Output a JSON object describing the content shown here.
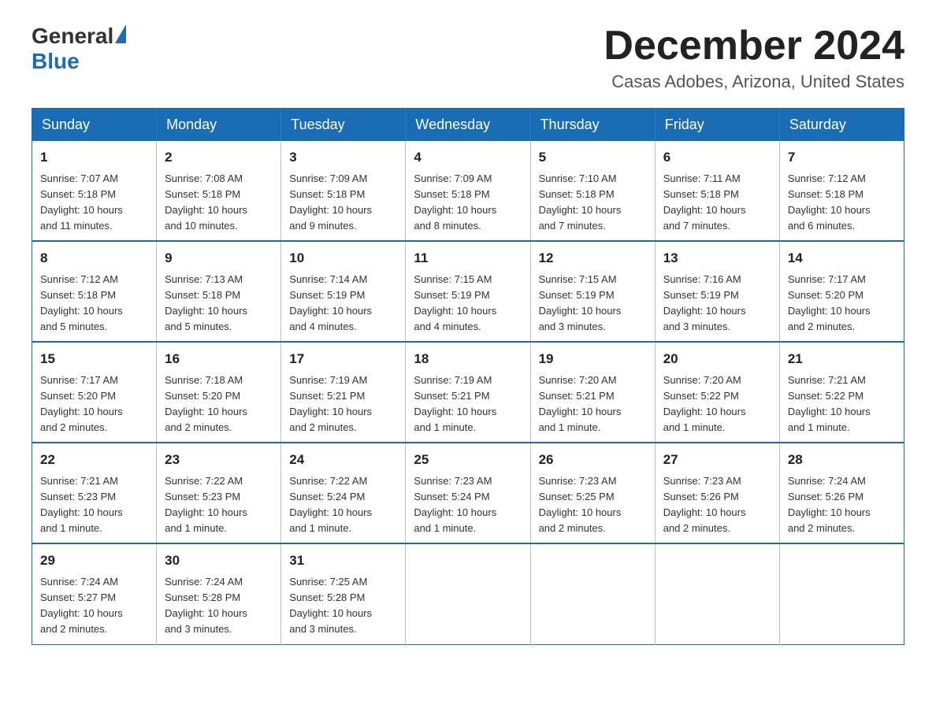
{
  "header": {
    "logo_general": "General",
    "logo_blue": "Blue",
    "month_title": "December 2024",
    "location": "Casas Adobes, Arizona, United States"
  },
  "days_of_week": [
    "Sunday",
    "Monday",
    "Tuesday",
    "Wednesday",
    "Thursday",
    "Friday",
    "Saturday"
  ],
  "weeks": [
    [
      {
        "day": "1",
        "sunrise": "7:07 AM",
        "sunset": "5:18 PM",
        "daylight": "10 hours and 11 minutes."
      },
      {
        "day": "2",
        "sunrise": "7:08 AM",
        "sunset": "5:18 PM",
        "daylight": "10 hours and 10 minutes."
      },
      {
        "day": "3",
        "sunrise": "7:09 AM",
        "sunset": "5:18 PM",
        "daylight": "10 hours and 9 minutes."
      },
      {
        "day": "4",
        "sunrise": "7:09 AM",
        "sunset": "5:18 PM",
        "daylight": "10 hours and 8 minutes."
      },
      {
        "day": "5",
        "sunrise": "7:10 AM",
        "sunset": "5:18 PM",
        "daylight": "10 hours and 7 minutes."
      },
      {
        "day": "6",
        "sunrise": "7:11 AM",
        "sunset": "5:18 PM",
        "daylight": "10 hours and 7 minutes."
      },
      {
        "day": "7",
        "sunrise": "7:12 AM",
        "sunset": "5:18 PM",
        "daylight": "10 hours and 6 minutes."
      }
    ],
    [
      {
        "day": "8",
        "sunrise": "7:12 AM",
        "sunset": "5:18 PM",
        "daylight": "10 hours and 5 minutes."
      },
      {
        "day": "9",
        "sunrise": "7:13 AM",
        "sunset": "5:18 PM",
        "daylight": "10 hours and 5 minutes."
      },
      {
        "day": "10",
        "sunrise": "7:14 AM",
        "sunset": "5:19 PM",
        "daylight": "10 hours and 4 minutes."
      },
      {
        "day": "11",
        "sunrise": "7:15 AM",
        "sunset": "5:19 PM",
        "daylight": "10 hours and 4 minutes."
      },
      {
        "day": "12",
        "sunrise": "7:15 AM",
        "sunset": "5:19 PM",
        "daylight": "10 hours and 3 minutes."
      },
      {
        "day": "13",
        "sunrise": "7:16 AM",
        "sunset": "5:19 PM",
        "daylight": "10 hours and 3 minutes."
      },
      {
        "day": "14",
        "sunrise": "7:17 AM",
        "sunset": "5:20 PM",
        "daylight": "10 hours and 2 minutes."
      }
    ],
    [
      {
        "day": "15",
        "sunrise": "7:17 AM",
        "sunset": "5:20 PM",
        "daylight": "10 hours and 2 minutes."
      },
      {
        "day": "16",
        "sunrise": "7:18 AM",
        "sunset": "5:20 PM",
        "daylight": "10 hours and 2 minutes."
      },
      {
        "day": "17",
        "sunrise": "7:19 AM",
        "sunset": "5:21 PM",
        "daylight": "10 hours and 2 minutes."
      },
      {
        "day": "18",
        "sunrise": "7:19 AM",
        "sunset": "5:21 PM",
        "daylight": "10 hours and 1 minute."
      },
      {
        "day": "19",
        "sunrise": "7:20 AM",
        "sunset": "5:21 PM",
        "daylight": "10 hours and 1 minute."
      },
      {
        "day": "20",
        "sunrise": "7:20 AM",
        "sunset": "5:22 PM",
        "daylight": "10 hours and 1 minute."
      },
      {
        "day": "21",
        "sunrise": "7:21 AM",
        "sunset": "5:22 PM",
        "daylight": "10 hours and 1 minute."
      }
    ],
    [
      {
        "day": "22",
        "sunrise": "7:21 AM",
        "sunset": "5:23 PM",
        "daylight": "10 hours and 1 minute."
      },
      {
        "day": "23",
        "sunrise": "7:22 AM",
        "sunset": "5:23 PM",
        "daylight": "10 hours and 1 minute."
      },
      {
        "day": "24",
        "sunrise": "7:22 AM",
        "sunset": "5:24 PM",
        "daylight": "10 hours and 1 minute."
      },
      {
        "day": "25",
        "sunrise": "7:23 AM",
        "sunset": "5:24 PM",
        "daylight": "10 hours and 1 minute."
      },
      {
        "day": "26",
        "sunrise": "7:23 AM",
        "sunset": "5:25 PM",
        "daylight": "10 hours and 2 minutes."
      },
      {
        "day": "27",
        "sunrise": "7:23 AM",
        "sunset": "5:26 PM",
        "daylight": "10 hours and 2 minutes."
      },
      {
        "day": "28",
        "sunrise": "7:24 AM",
        "sunset": "5:26 PM",
        "daylight": "10 hours and 2 minutes."
      }
    ],
    [
      {
        "day": "29",
        "sunrise": "7:24 AM",
        "sunset": "5:27 PM",
        "daylight": "10 hours and 2 minutes."
      },
      {
        "day": "30",
        "sunrise": "7:24 AM",
        "sunset": "5:28 PM",
        "daylight": "10 hours and 3 minutes."
      },
      {
        "day": "31",
        "sunrise": "7:25 AM",
        "sunset": "5:28 PM",
        "daylight": "10 hours and 3 minutes."
      },
      null,
      null,
      null,
      null
    ]
  ],
  "labels": {
    "sunrise": "Sunrise:",
    "sunset": "Sunset:",
    "daylight": "Daylight:"
  }
}
